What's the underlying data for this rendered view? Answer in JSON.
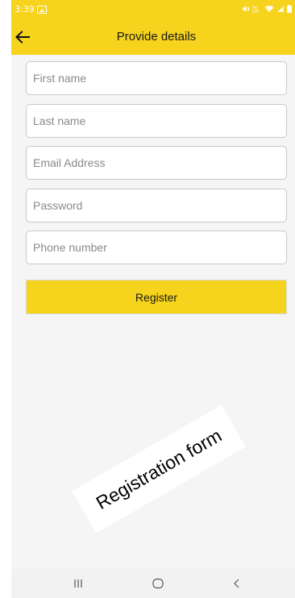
{
  "status_bar": {
    "time": "3:39",
    "background": "#f6d31d",
    "icons": [
      "gallery-icon",
      "mute-icon",
      "volte-icon",
      "wifi-icon",
      "signal-icon",
      "battery-icon"
    ]
  },
  "app_bar": {
    "title": "Provide details",
    "back_icon": "arrow-left-icon",
    "background": "#f6d31d"
  },
  "form": {
    "fields": [
      {
        "placeholder": "First name",
        "value": ""
      },
      {
        "placeholder": "Last name",
        "value": ""
      },
      {
        "placeholder": "Email Address",
        "value": ""
      },
      {
        "placeholder": "Password",
        "value": ""
      },
      {
        "placeholder": "Phone number",
        "value": ""
      }
    ],
    "register_label": "Register",
    "accent": "#f6d31d"
  },
  "caption": "Registration form",
  "nav_bar": {
    "icons": [
      "recent-apps-icon",
      "home-icon",
      "back-icon"
    ]
  }
}
